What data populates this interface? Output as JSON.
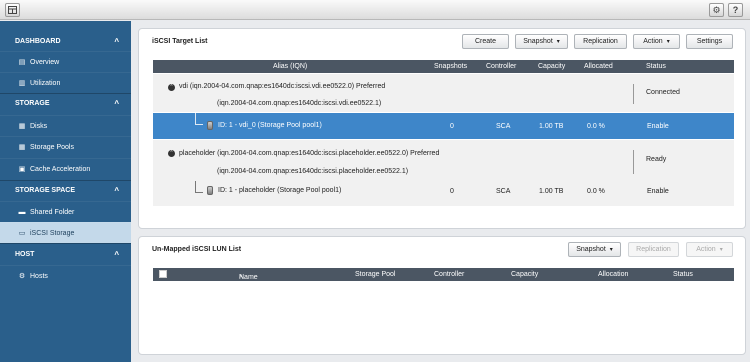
{
  "topbar": {
    "app_icon": "grid-icon",
    "settings_icon": "gear-icon",
    "help_label": "?"
  },
  "sidebar": {
    "sections": [
      {
        "label": "DASHBOARD",
        "chevron": "^"
      },
      {
        "label": "STORAGE",
        "chevron": "^"
      },
      {
        "label": "STORAGE SPACE",
        "chevron": "^"
      },
      {
        "label": "HOST",
        "chevron": "^"
      }
    ],
    "items": [
      {
        "label": "Overview",
        "icon": "overview-icon"
      },
      {
        "label": "Utilization",
        "icon": "chart-icon"
      },
      {
        "label": "Disks",
        "icon": "disks-icon"
      },
      {
        "label": "Storage Pools",
        "icon": "pools-icon"
      },
      {
        "label": "Cache Acceleration",
        "icon": "cache-icon"
      },
      {
        "label": "Shared Folder",
        "icon": "folder-icon"
      },
      {
        "label": "iSCSI Storage",
        "icon": "iscsi-icon"
      },
      {
        "label": "Hosts",
        "icon": "gear-icon"
      }
    ]
  },
  "target_panel": {
    "title": "iSCSI Target List",
    "buttons": {
      "create": "Create",
      "snapshot": "Snapshot",
      "replication": "Replication",
      "action": "Action",
      "settings": "Settings"
    },
    "columns": [
      "Alias (IQN)",
      "Snapshots",
      "Controller",
      "Capacity",
      "Allocated",
      "Status"
    ],
    "targets": [
      {
        "line1": "vdi (iqn.2004-04.com.qnap:es1640dc:iscsi.vdi.ee0522.0) Preferred",
        "line2": "(iqn.2004-04.com.qnap:es1640dc:iscsi.vdi.ee0522.1)",
        "status": "Connected",
        "lun": {
          "id": "ID: 1 - vdi_0 (Storage Pool pool1)",
          "snapshots": "0",
          "controller": "SCA",
          "capacity": "1.00 TB",
          "allocated": "0.0 %",
          "status": "Enable"
        }
      },
      {
        "line1": "placeholder (iqn.2004-04.com.qnap:es1640dc:iscsi.placeholder.ee0522.0) Preferred",
        "line2": "(iqn.2004-04.com.qnap:es1640dc:iscsi.placeholder.ee0522.1)",
        "status": "Ready",
        "lun": {
          "id": "ID: 1 - placeholder (Storage Pool pool1)",
          "snapshots": "0",
          "controller": "SCA",
          "capacity": "1.00 TB",
          "allocated": "0.0 %",
          "status": "Enable"
        }
      }
    ]
  },
  "unmapped_panel": {
    "title": "Un-Mapped iSCSI LUN List",
    "buttons": {
      "snapshot": "Snapshot",
      "replication": "Replication",
      "action": "Action"
    },
    "columns": [
      "Name",
      "Storage Pool",
      "Controller",
      "Capacity",
      "Allocation",
      "Status"
    ],
    "sort_indicator": "˄"
  }
}
